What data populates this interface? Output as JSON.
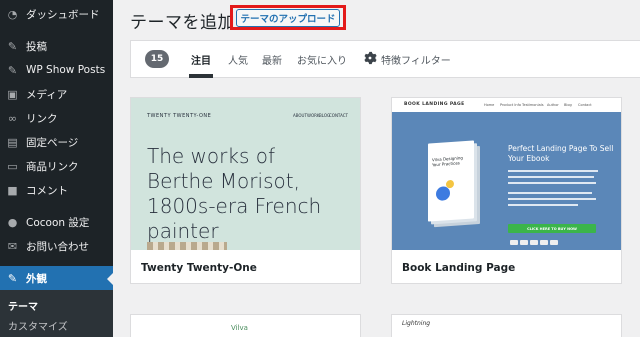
{
  "sidebar": {
    "items": [
      {
        "label": "ダッシュボード",
        "icon": "dashboard-icon"
      },
      {
        "label": "投稿",
        "icon": "pin-icon"
      },
      {
        "label": "WP Show Posts",
        "icon": "pin-icon"
      },
      {
        "label": "メディア",
        "icon": "media-icon"
      },
      {
        "label": "リンク",
        "icon": "link-icon"
      },
      {
        "label": "固定ページ",
        "icon": "page-icon"
      },
      {
        "label": "商品リンク",
        "icon": "product-link-icon"
      },
      {
        "label": "コメント",
        "icon": "comment-icon"
      },
      {
        "label": "Cocoon 設定",
        "icon": "cocoon-icon"
      },
      {
        "label": "お問い合わせ",
        "icon": "mail-icon"
      },
      {
        "label": "外観",
        "icon": "appearance-icon"
      }
    ],
    "submenu": [
      {
        "label": "テーマ"
      },
      {
        "label": "カスタマイズ"
      }
    ]
  },
  "header": {
    "title": "テーマを追加",
    "upload_button": "テーマのアップロード"
  },
  "filter_bar": {
    "count": "15",
    "tabs": [
      {
        "label": "注目"
      },
      {
        "label": "人気"
      },
      {
        "label": "最新"
      },
      {
        "label": "お気に入り"
      }
    ],
    "feature_filter": "特徴フィルター"
  },
  "themes": [
    {
      "name": "Twenty Twenty-One",
      "preview": {
        "site_name": "TWENTY TWENTY-ONE",
        "nav": [
          "ABOUT",
          "WORK",
          "BLOG",
          "CONTACT"
        ],
        "headline": "The works of Berthe Morisot, 1800s-era French painter"
      }
    },
    {
      "name": "Book Landing Page",
      "preview": {
        "logo": "BOOK LANDING PAGE",
        "nav": [
          "Home",
          "Product Info",
          "Testimonials",
          "Author",
          "Blog",
          "Contact"
        ],
        "cover_text": "Vilva Designing Your Practices",
        "hero_title": "Perfect Landing Page To Sell Your Ebook",
        "cta": "CLICK HERE TO BUY NOW"
      }
    },
    {
      "name": "",
      "preview": {
        "logo": "Vilva"
      }
    },
    {
      "name": "",
      "preview": {
        "logo": "Lightning"
      }
    }
  ],
  "colors": {
    "sidebar_bg": "#1d2327",
    "active_menu": "#2271b1",
    "highlight_box": "#e31a1a",
    "tt1_bg": "#d1e4dd",
    "book_hero_bg": "#5b87b8"
  }
}
